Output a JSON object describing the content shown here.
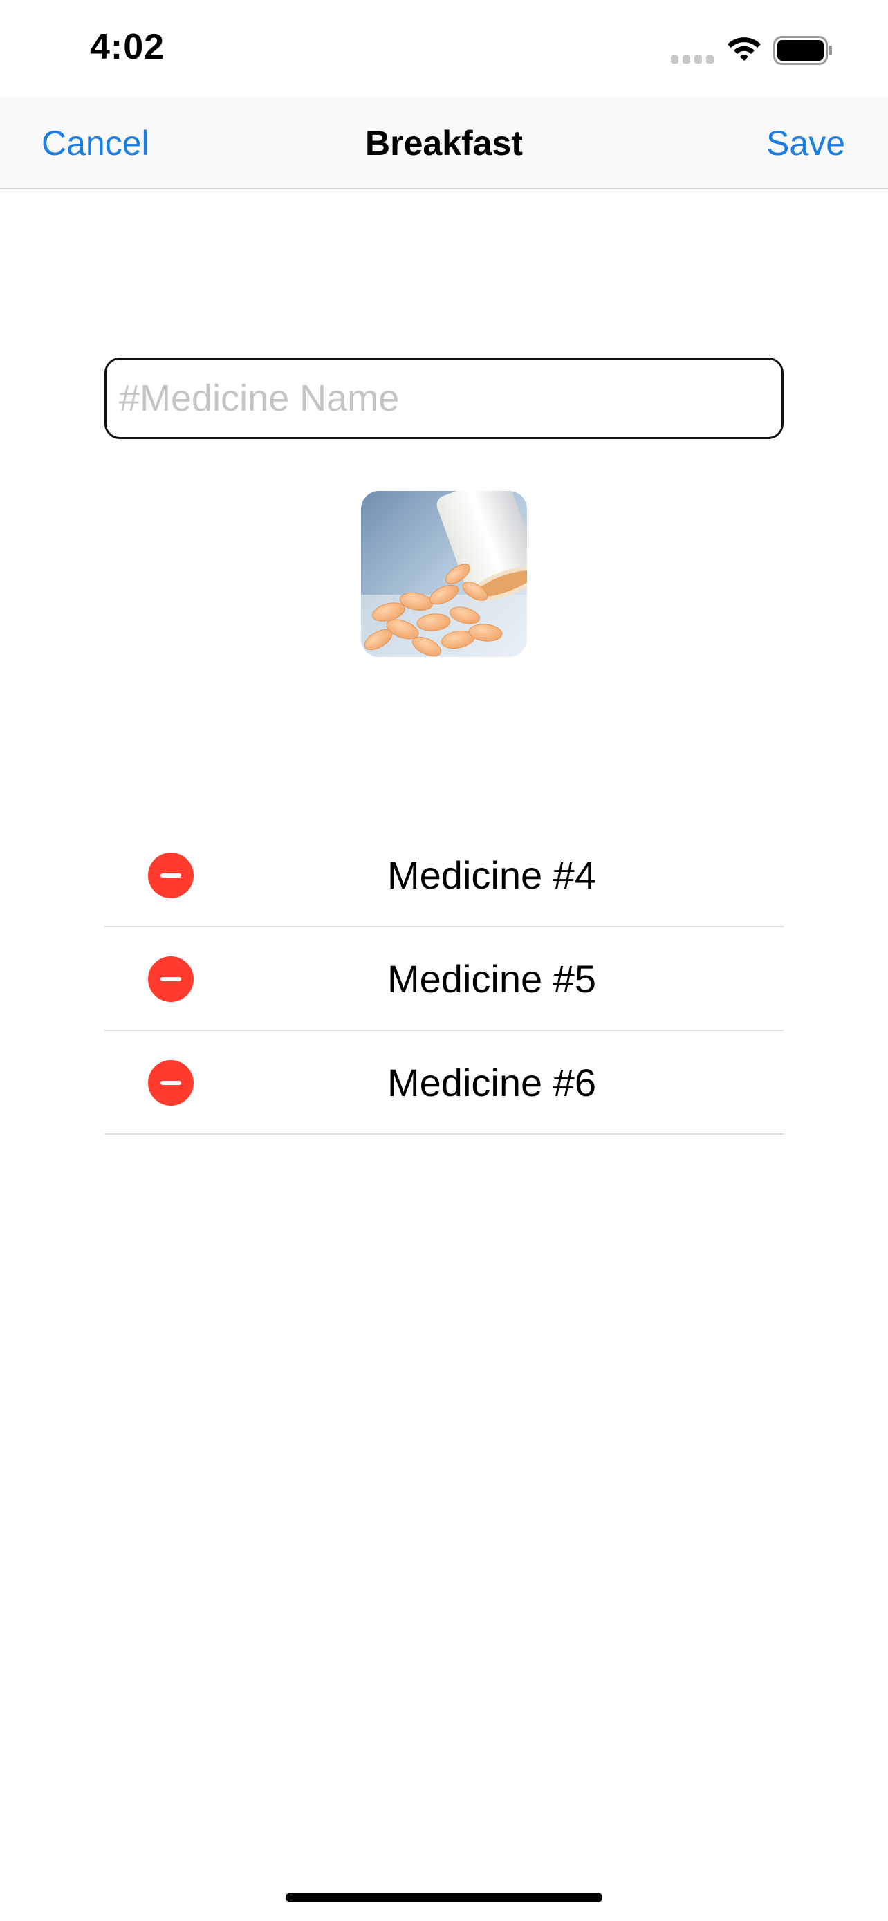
{
  "status_bar": {
    "time": "4:02",
    "icons": [
      "signal-icon",
      "wifi-icon",
      "battery-icon"
    ]
  },
  "nav": {
    "cancel_label": "Cancel",
    "title": "Breakfast",
    "save_label": "Save",
    "accent_color": "#1a7ee6"
  },
  "form": {
    "name_placeholder": "#Medicine Name",
    "name_value": ""
  },
  "medicine_image": {
    "icon": "pill-bottle-image"
  },
  "medicines": [
    {
      "label": "Medicine #4"
    },
    {
      "label": "Medicine #5"
    },
    {
      "label": "Medicine #6"
    }
  ],
  "colors": {
    "delete": "#ff3b30",
    "separator": "#dedede"
  }
}
